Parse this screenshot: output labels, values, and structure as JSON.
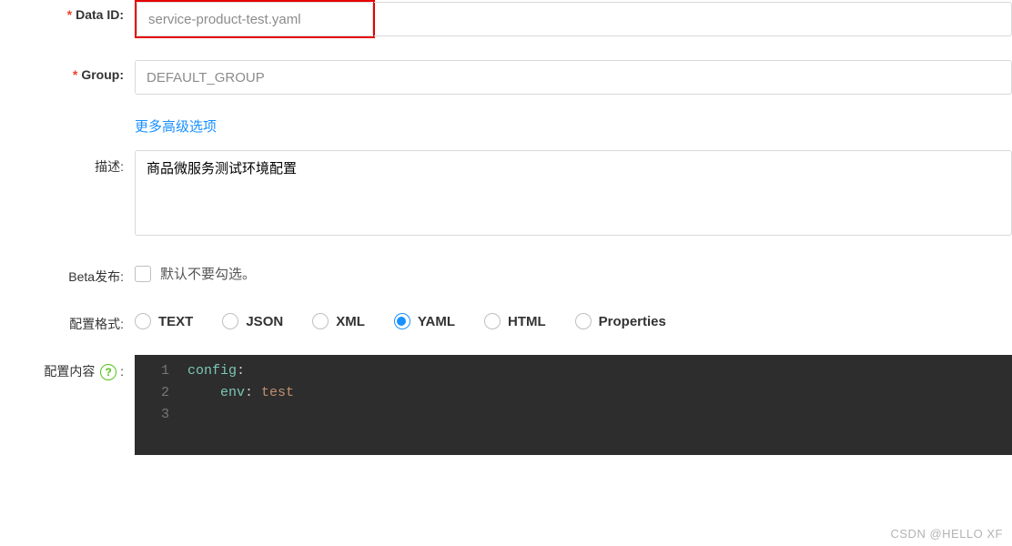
{
  "fields": {
    "dataId": {
      "label": "Data ID:",
      "value": "service-product-test.yaml"
    },
    "group": {
      "label": "Group:",
      "value": "DEFAULT_GROUP"
    },
    "moreOptions": "更多高级选项",
    "description": {
      "label": "描述:",
      "value": "商品微服务测试环境配置"
    },
    "beta": {
      "label": "Beta发布:",
      "hint": "默认不要勾选。",
      "checked": false
    },
    "format": {
      "label": "配置格式:",
      "options": [
        "TEXT",
        "JSON",
        "XML",
        "YAML",
        "HTML",
        "Properties"
      ],
      "selected": "YAML"
    },
    "content": {
      "label": "配置内容",
      "help": "?"
    }
  },
  "code": {
    "lines": [
      {
        "n": 1,
        "indent": 0,
        "key": "config",
        "colon": ":",
        "val": ""
      },
      {
        "n": 2,
        "indent": 1,
        "key": "env",
        "colon": ": ",
        "val": "test"
      },
      {
        "n": 3,
        "indent": 0,
        "key": "",
        "colon": "",
        "val": ""
      }
    ]
  },
  "watermark": "CSDN @HELLO XF"
}
